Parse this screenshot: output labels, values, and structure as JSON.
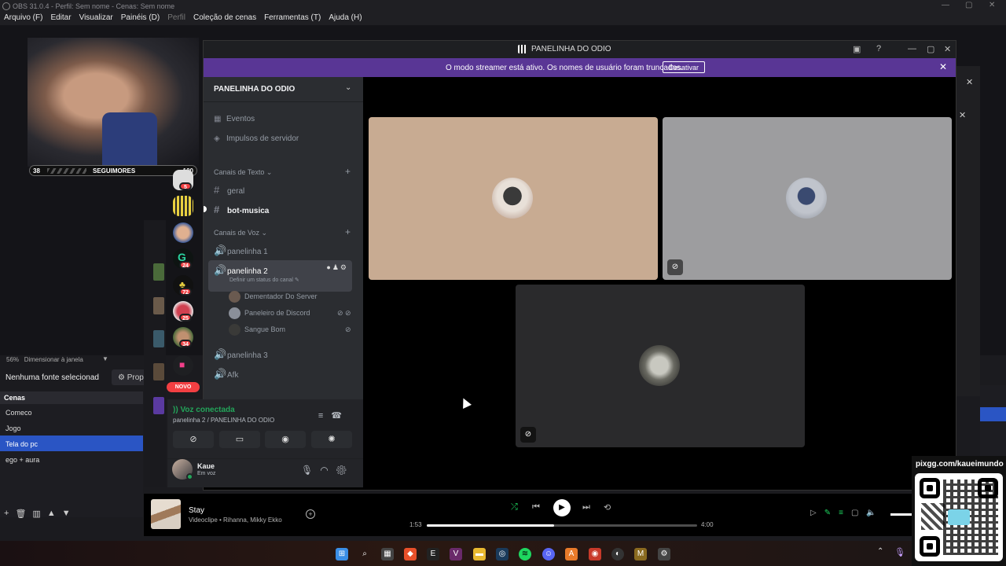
{
  "obs": {
    "title": "OBS 31.0.4 - Perfil: Sem nome - Cenas: Sem nome",
    "menu": [
      "Arquivo (F)",
      "Editar",
      "Visualizar",
      "Painéis (D)",
      "Perfil",
      "Coleção de cenas",
      "Ferramentas (T)",
      "Ajuda (H)"
    ],
    "zoom": "56%",
    "zoom_mode": "Dimensionar à janela",
    "no_source": "Nenhuma fonte selecionad",
    "properties": "Prop",
    "scenes_header": "Cenas",
    "scenes": [
      "Comeco",
      "Jogo",
      "Tela do pc",
      "ego + aura"
    ],
    "active_scene": "Tela do pc"
  },
  "overlay": {
    "followers_left": "38",
    "followers_label": "SEGUIMORES",
    "followers_right": "100",
    "qr_label": "pixgg.com/kaueimundo"
  },
  "discord": {
    "window_title": "PANELINHA DO ODIO",
    "streamer_banner": "O modo streamer está ativo. Os nomes de usuário foram truncados.",
    "streamer_button": "Desativar",
    "server_name": "PANELINHA DO ODIO",
    "events": "Eventos",
    "boosts": "Impulsos de servidor",
    "text_category": "Canais de Texto",
    "text_channels": [
      "geral",
      "bot-musica"
    ],
    "voice_category": "Canais de Voz",
    "voice_channels": [
      "panelinha 1",
      "panelinha 2",
      "panelinha 3",
      "Afk"
    ],
    "channel_status_placeholder": "Definir um status do canal",
    "voice_users": [
      "Dementador Do Server",
      "Paneleiro de Discord",
      "Sangue Bom"
    ],
    "server_badges": [
      "5",
      "24",
      "72",
      "25",
      "34"
    ],
    "novo_label": "NOVO",
    "voice_connected": "Voz conectada",
    "voice_location": "panelinha 2 / PANELINHA DO ODIO",
    "user_name": "Kaue",
    "user_status": "Em voz"
  },
  "spotify": {
    "track": "Stay",
    "artists": "Videoclipe • Rihanna, Mikky Ekko",
    "elapsed": "1:53",
    "total": "4:00",
    "progress_fraction": 0.47
  }
}
